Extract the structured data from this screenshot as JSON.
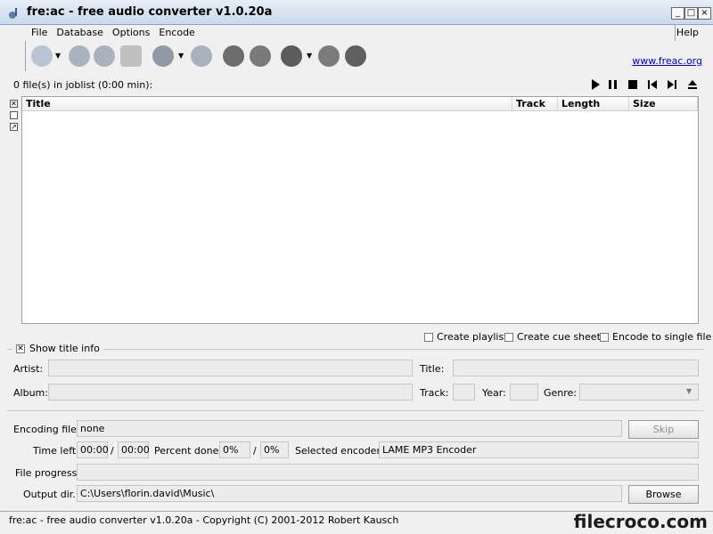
{
  "window": {
    "title": "fre:ac - free audio converter v1.0.20a"
  },
  "menu": {
    "file": "File",
    "database": "Database",
    "options": "Options",
    "encode": "Encode",
    "help": "Help"
  },
  "toolbar": {
    "icons": [
      "add-files-icon",
      "add-folder-icon",
      "cd-rip-icon",
      "recycle-icon",
      "search-icon",
      "cddb-icon",
      "tools-icon",
      "settings-icon",
      "play-icon",
      "pause-icon",
      "stop-icon"
    ],
    "link": "www.freac.org"
  },
  "joblist": {
    "count_text": "0 file(s) in joblist (0:00 min):",
    "columns": [
      "Title",
      "Track",
      "Length",
      "Size"
    ]
  },
  "options": {
    "create_playlist": "Create playlist",
    "create_cue": "Create cue sheet",
    "single_file": "Encode to single file"
  },
  "title_info": {
    "show_label": "Show title info",
    "artist_label": "Artist:",
    "title_label": "Title:",
    "album_label": "Album:",
    "track_label": "Track:",
    "year_label": "Year:",
    "genre_label": "Genre:"
  },
  "encoding": {
    "encoding_file_label": "Encoding file:",
    "encoding_file_value": "none",
    "skip_label": "Skip",
    "time_left_label": "Time left:",
    "time_left_1": "00:00",
    "time_sep": "/",
    "time_left_2": "00:00",
    "percent_done_label": "Percent done:",
    "percent_1": "0%",
    "percent_sep": "/",
    "percent_2": "0%",
    "selected_encoder_label": "Selected encoder:",
    "selected_encoder_value": "LAME MP3 Encoder",
    "file_progress_label": "File progress:",
    "output_dir_label": "Output dir.:",
    "output_dir_value": "C:\\Users\\florin.david\\Music\\",
    "browse_label": "Browse"
  },
  "status": {
    "text": "fre:ac - free audio converter v1.0.20a - Copyright (C) 2001-2012 Robert Kausch",
    "watermark": "filecroco.com"
  }
}
